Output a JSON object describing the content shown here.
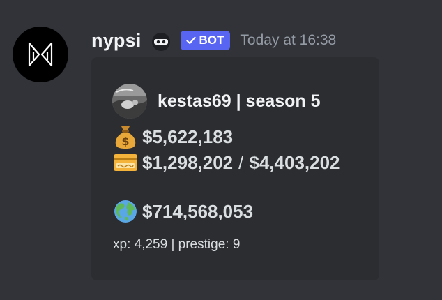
{
  "message": {
    "author": {
      "name": "nypsi",
      "tag": "BOT",
      "timestamp": "Today at 16:38"
    },
    "embed": {
      "author_name": "kestas69 | season 5",
      "wallet": {
        "icon": "money-bag-icon",
        "value": "$5,622,183"
      },
      "bank": {
        "icon": "credit-card-icon",
        "value": "$1,298,202",
        "separator": "/",
        "max": "$4,403,202"
      },
      "networth": {
        "icon": "globe-icon",
        "value": "$714,568,053"
      },
      "footer": "xp: 4,259 | prestige: 9"
    }
  },
  "colors": {
    "background": "#313338",
    "embed_background": "#2b2d31",
    "bot_tag": "#5865f2",
    "timestamp": "#949ba4",
    "username": "#f2f3f5"
  }
}
